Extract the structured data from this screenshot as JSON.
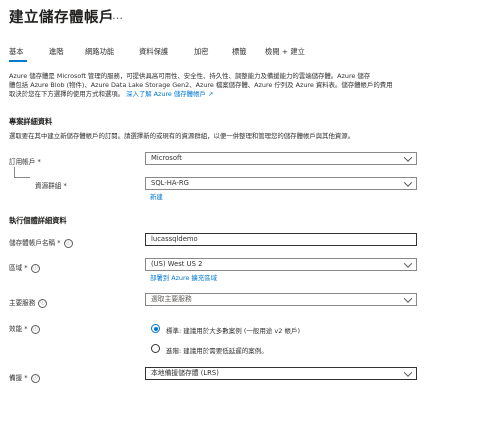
{
  "header": {
    "title": "建立儲存體帳戶",
    "more": "…"
  },
  "tabs": [
    "基本",
    "進階",
    "網路功能",
    "資料保護",
    "加密",
    "標籤",
    "檢閱 + 建立"
  ],
  "description": {
    "line1": "Azure 儲存體是 Microsoft 管理的服務，可提供具高可用性、安全性、持久性、調整能力及備援能力的雲端儲存體。Azure 儲存",
    "line2": "體包括 Azure Blob (物件)、Azure Data Lake Storage Gen2、Azure 檔案儲存體、Azure 佇列及 Azure 資料表。儲存體帳戶的費用",
    "line3": "取決於您在下方選擇的使用方式和選項。",
    "link": "深入了解 Azure 儲存體帳戶 ↗"
  },
  "project": {
    "heading": "專案詳細資料",
    "subtitle": "選取要在其中建立新儲存體帳戶的訂閱。請選擇新的或現有的資源群組，以便一併整理和管理您的儲存體帳戶與其他資源。",
    "subscription_label": "訂用帳戶 *",
    "subscription_value": "Microsoft",
    "resource_group_label": "資源群組 *",
    "resource_group_value": "SQL-HA-RG",
    "create_new": "新建"
  },
  "instance": {
    "heading": "執行個體詳細資料",
    "name_label": "儲存體帳戶名稱 *",
    "name_value": "lucassqldemo",
    "region_label": "區域 *",
    "region_value": "(US) West US 2",
    "edge_link": "部署到 Azure 擴充區域",
    "primary_service_label": "主要服務",
    "primary_service_placeholder": "選取主要服務",
    "performance_label": "效能 *",
    "perf_standard": "標準: 建議用於大多數案例 (一般用途 v2 帳戶)",
    "perf_premium": "進階: 建議用於需要低延遲的案例。",
    "redundancy_label": "備援 *",
    "redundancy_value": "本地備援儲存體 (LRS)"
  },
  "icons": {
    "info": "ⓘ",
    "info_name": "info-icon"
  },
  "colors": {
    "accent": "#0078d4",
    "text": "#323130"
  }
}
